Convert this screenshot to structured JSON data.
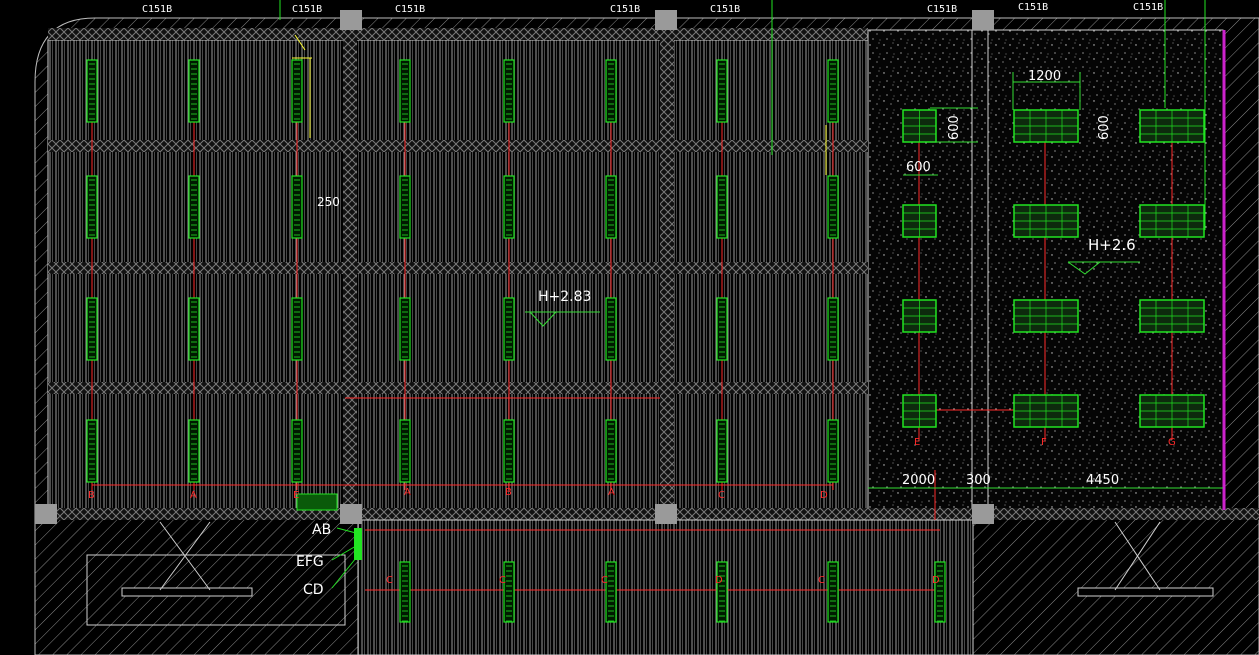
{
  "drawing": {
    "top_tags": [
      "C151B",
      "C151B",
      "C151B",
      "C151B",
      "C151B",
      "C151B",
      "C151B",
      "C151B"
    ],
    "elevation_left": "H+2.83",
    "elevation_right": "H+2.6",
    "dims": {
      "d250": "250",
      "d1200": "1200",
      "d600a": "600",
      "d600b": "600",
      "d600c": "600",
      "bottom": [
        "2000",
        "300",
        "4450"
      ]
    },
    "legend": [
      "AB",
      "EFG",
      "CD"
    ],
    "grid_right_labels": [
      "E",
      "F",
      "G"
    ],
    "row_bottom_labels": [
      "B",
      "A",
      "E",
      "A",
      "B",
      "A",
      "C",
      "D"
    ],
    "corridor_labels": [
      "C",
      "C",
      "C",
      "D",
      "C",
      "D"
    ]
  },
  "colors": {
    "background": "#000000",
    "fixture": "#22e422",
    "wire": "#ff2a2a",
    "text": "#ffffff",
    "accent": "#cc22cc",
    "dim": "#ffff33"
  }
}
